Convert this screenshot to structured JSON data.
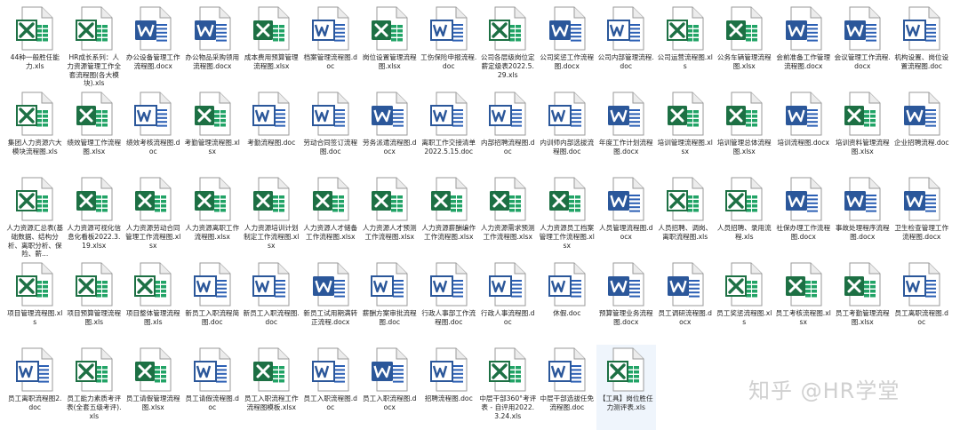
{
  "watermark": "知乎 @HR学堂",
  "files": [
    {
      "name": "44种一般胜任能力.xls",
      "type": "excel-old"
    },
    {
      "name": "HR成长系列：人力资源管理工作全套流程图(各大模块).xls",
      "type": "excel-old"
    },
    {
      "name": "办公设备管理工作流程图.docx",
      "type": "word"
    },
    {
      "name": "办公物品采购领用流程图.docx",
      "type": "word"
    },
    {
      "name": "成本费用预算管理流程图.xlsx",
      "type": "excel"
    },
    {
      "name": "档案管理流程图.doc",
      "type": "word-old"
    },
    {
      "name": "岗位设置管理流程图.xlsx",
      "type": "excel"
    },
    {
      "name": "工伤保险申报流程.doc",
      "type": "word-old"
    },
    {
      "name": "公司各层级岗位定薪定级表2022.5.29.xls",
      "type": "excel-old"
    },
    {
      "name": "公司奖惩工作流程图.docx",
      "type": "word"
    },
    {
      "name": "公司内部管理流程.doc",
      "type": "word-old"
    },
    {
      "name": "公司运营流程图.xls",
      "type": "excel-old"
    },
    {
      "name": "公务车辆管理流程图.xlsx",
      "type": "excel"
    },
    {
      "name": "会前准备工作管理流程图.docx",
      "type": "word"
    },
    {
      "name": "会议管理工作流程.docx",
      "type": "word"
    },
    {
      "name": "机构设置、岗位设置流程图.doc",
      "type": "word-old"
    },
    {
      "name": "集团人力资源六大模块流程图.xls",
      "type": "excel-old"
    },
    {
      "name": "绩效管理工作流程图.xlsx",
      "type": "excel"
    },
    {
      "name": "绩效考核流程图.doc",
      "type": "word-old"
    },
    {
      "name": "考勤管理流程图.xlsx",
      "type": "excel"
    },
    {
      "name": "考勤流程图.doc",
      "type": "word-old"
    },
    {
      "name": "劳动合同签订流程图.doc",
      "type": "word-old"
    },
    {
      "name": "劳务派遣流程图.docx",
      "type": "word"
    },
    {
      "name": "离职工作交接清单2022.5.15.doc",
      "type": "word-old"
    },
    {
      "name": "内部招聘流程图.doc",
      "type": "word-old"
    },
    {
      "name": "内训师内部选拔流程图.doc",
      "type": "word-old"
    },
    {
      "name": "年度工作计划流程图.docx",
      "type": "word"
    },
    {
      "name": "培训管理流程图.xlsx",
      "type": "excel"
    },
    {
      "name": "培训管理总体流程图.xlsx",
      "type": "excel"
    },
    {
      "name": "培训流程图.docx",
      "type": "word"
    },
    {
      "name": "培训资料管理流程图.xlsx",
      "type": "excel"
    },
    {
      "name": "企业招聘流程.doc",
      "type": "word"
    },
    {
      "name": "人力资源汇总表(基础数据、结构分析、离职分析、保险、薪...",
      "type": "excel-old"
    },
    {
      "name": "人力资源可视化信息化看板2022.3.19.xlsx",
      "type": "excel"
    },
    {
      "name": "人力资源劳动合同管理工作流程图.xlsx",
      "type": "excel"
    },
    {
      "name": "人力资源离职工作流程图.xlsx",
      "type": "excel"
    },
    {
      "name": "人力资源培训计划制定工作流程图.xlsx",
      "type": "excel"
    },
    {
      "name": "人力资源人才储备工作流程图.xlsx",
      "type": "excel"
    },
    {
      "name": "人力资源人才预测工作流程图.xlsx",
      "type": "excel"
    },
    {
      "name": "人力资源薪酬编作工作流程图.xlsx",
      "type": "excel"
    },
    {
      "name": "人力资源需求预测工作流程图.xlsx",
      "type": "excel"
    },
    {
      "name": "人力资源员工档案管理工作流程图.xlsx",
      "type": "excel"
    },
    {
      "name": "人员管理流程图.docx",
      "type": "word"
    },
    {
      "name": "人员招聘、调岗、离职流程图.xls",
      "type": "excel-old"
    },
    {
      "name": "人员招聘、录用流程.xls",
      "type": "excel-old"
    },
    {
      "name": "社保办理工作流程图.docx",
      "type": "word"
    },
    {
      "name": "事故处理程序流程图.docx",
      "type": "word"
    },
    {
      "name": "卫生检查管理工作流程图.docx",
      "type": "word"
    },
    {
      "name": "项目管理流程图.xls",
      "type": "excel-old"
    },
    {
      "name": "项目预算管理流程图.xls",
      "type": "excel-old"
    },
    {
      "name": "项目整体管理流程图.xls",
      "type": "excel-old"
    },
    {
      "name": "新员工入职流程简图.doc",
      "type": "word-old"
    },
    {
      "name": "新员工入职流程图.doc",
      "type": "word-old"
    },
    {
      "name": "新员工试用期满转正流程.docx",
      "type": "word"
    },
    {
      "name": "薪酬方案审批流程图.doc",
      "type": "word-old"
    },
    {
      "name": "行政人事部工作流程图.doc",
      "type": "word-old"
    },
    {
      "name": "行政人事流程图.doc",
      "type": "word-old"
    },
    {
      "name": "休假.doc",
      "type": "word-old"
    },
    {
      "name": "预算管理业务流程图.docx",
      "type": "word"
    },
    {
      "name": "员工调研流程图.docx",
      "type": "word"
    },
    {
      "name": "员工奖惩流程图.xls",
      "type": "excel-old"
    },
    {
      "name": "员工考核流程图.xlsx",
      "type": "excel"
    },
    {
      "name": "员工考勤管理流程图.xlsx",
      "type": "excel"
    },
    {
      "name": "员工离职流程图.doc",
      "type": "word-old"
    },
    {
      "name": "员工离职流程图2.doc",
      "type": "word-old"
    },
    {
      "name": "员工能力素质考评表(全套五级考评).xls",
      "type": "excel-old"
    },
    {
      "name": "员工请假管理流程图.xlsx",
      "type": "excel"
    },
    {
      "name": "员工请假流程图.doc",
      "type": "word-old"
    },
    {
      "name": "员工入职流程工作流程图模板.xlsx",
      "type": "excel"
    },
    {
      "name": "员工入职流程图.doc",
      "type": "word-old"
    },
    {
      "name": "员工入职流程图.docx",
      "type": "word"
    },
    {
      "name": "招聘流程图.doc",
      "type": "word-old"
    },
    {
      "name": "中层干部360°考评表 - 自评用2022.3.24.xls",
      "type": "excel-old"
    },
    {
      "name": "中层干部选拔任免流程图.doc",
      "type": "word-old"
    },
    {
      "name": "【工具】岗位胜任力测评表.xls",
      "type": "excel-old",
      "selected": true
    }
  ]
}
